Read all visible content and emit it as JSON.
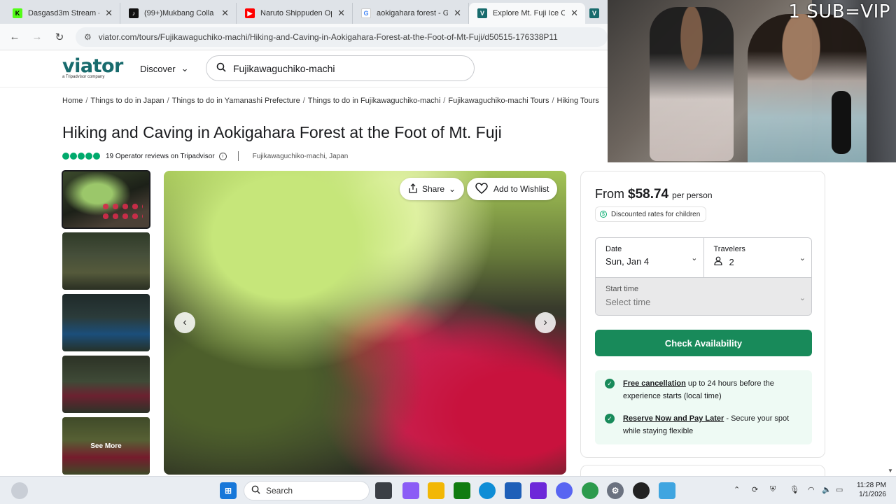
{
  "browser": {
    "tabs": [
      {
        "label": "Dasgasd3m Stream - W",
        "icon": "kick-icon",
        "color": "#53fc18"
      },
      {
        "label": "(99+)Mukbang Colla",
        "icon": "tiktok-icon",
        "color": "#111111"
      },
      {
        "label": "Naruto Shippuden Ope",
        "icon": "youtube-icon",
        "color": "#ff0000"
      },
      {
        "label": "aokigahara forest - Goo",
        "icon": "google-icon",
        "color": "#4285f4"
      },
      {
        "label": "Explore Mt. Fuji Ice Cave",
        "icon": "viator-icon",
        "color": "#186b6d"
      },
      {
        "label": "",
        "icon": "viator-icon",
        "color": "#186b6d"
      }
    ],
    "url": "viator.com/tours/Fujikawaguchiko-machi/Hiking-and-Caving-in-Aokigahara-Forest-at-the-Foot-of-Mt-Fuji/d50515-176338P11"
  },
  "webcam": {
    "overlay_text": "1 SUB=VIP"
  },
  "header": {
    "logo": "viator",
    "logo_sub": "a Tripadvisor company",
    "discover": "Discover",
    "search_value": "Fujikawaguchiko-machi"
  },
  "breadcrumbs": [
    "Home",
    "Things to do in Japan",
    "Things to do in Yamanashi Prefecture",
    "Things to do in Fujikawaguchiko-machi",
    "Fujikawaguchiko-machi Tours",
    "Hiking Tours"
  ],
  "product": {
    "title": "Hiking and Caving in Aokigahara Forest at the Foot of Mt. Fuji",
    "rating_bubbles": 5,
    "reviews": "19 Operator reviews on Tripadvisor",
    "location": "Fujikawaguchiko-machi, Japan"
  },
  "gallery": {
    "share": "Share",
    "wishlist": "Add to Wishlist",
    "see_more": "See More"
  },
  "booking": {
    "from": "From",
    "price": "$58.74",
    "per": "per person",
    "discount": "Discounted rates for children",
    "date_label": "Date",
    "date_value": "Sun, Jan 4",
    "travelers_label": "Travelers",
    "travelers_value": "2",
    "time_label": "Start time",
    "time_placeholder": "Select time",
    "check_button": "Check Availability",
    "benefits": [
      {
        "link": "Free cancellation",
        "text": " up to 24 hours before the experience starts (local time)"
      },
      {
        "link": "Reserve Now and Pay Later",
        "text": " - Secure your spot while staying flexible"
      }
    ]
  },
  "taskbar": {
    "search": "Search",
    "time": "11:28 PM",
    "date": "1/1/2026",
    "chrome_badge": "13",
    "discord_badge": "99+"
  }
}
